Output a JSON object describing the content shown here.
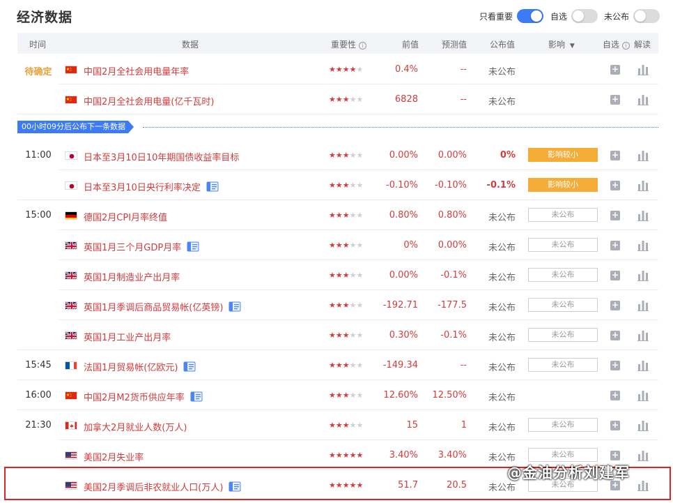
{
  "header": {
    "title": "经济数据",
    "toggles": [
      {
        "label": "只看重要",
        "on": true
      },
      {
        "label": "自选",
        "on": false
      },
      {
        "label": "未公布",
        "on": false
      }
    ]
  },
  "columns": {
    "time": "时间",
    "data": "数据",
    "importance": "重要性",
    "previous": "前值",
    "forecast": "预测值",
    "actual": "公布值",
    "impact": "影响",
    "watchlist": "自选",
    "analysis": "解读"
  },
  "banner": "00小时09分后公布下一条数据",
  "rows": [
    {
      "time": "待确定",
      "flag": "cn",
      "name": "中国2月全社会用电量年率",
      "doc": false,
      "stars": 4,
      "prev": "0.4%",
      "forecast": "--",
      "actual": "未公布",
      "actual_hot": false,
      "impact": ""
    },
    {
      "time": "",
      "flag": "cn",
      "name": "中国2月全社会用电量(亿千瓦时)",
      "doc": false,
      "stars": 3,
      "prev": "6828",
      "forecast": "--",
      "actual": "未公布",
      "actual_hot": false,
      "impact": ""
    },
    {
      "time": "11:00",
      "flag": "jp",
      "name": "日本至3月10日10年期国债收益率目标",
      "doc": false,
      "stars": 3,
      "prev": "0.00%",
      "forecast": "0.00%",
      "actual": "0%",
      "actual_hot": true,
      "impact": "影响较小"
    },
    {
      "time": "",
      "flag": "jp",
      "name": "日本至3月10日央行利率决定",
      "doc": true,
      "stars": 3,
      "prev": "-0.10%",
      "forecast": "-0.10%",
      "actual": "-0.1%",
      "actual_hot": true,
      "impact": "影响较小"
    },
    {
      "time": "15:00",
      "flag": "de",
      "name": "德国2月CPI月率终值",
      "doc": false,
      "stars": 3,
      "prev": "0.80%",
      "forecast": "0.80%",
      "actual": "未公布",
      "actual_hot": false,
      "impact": "未公布"
    },
    {
      "time": "",
      "flag": "uk",
      "name": "英国1月三个月GDP月率",
      "doc": true,
      "stars": 3,
      "prev": "0%",
      "forecast": "0.00%",
      "actual": "未公布",
      "actual_hot": false,
      "impact": "未公布"
    },
    {
      "time": "",
      "flag": "uk",
      "name": "英国1月制造业产出月率",
      "doc": false,
      "stars": 3,
      "prev": "0.00%",
      "forecast": "-0.1%",
      "actual": "未公布",
      "actual_hot": false,
      "impact": "未公布"
    },
    {
      "time": "",
      "flag": "uk",
      "name": "英国1月季调后商品贸易帐(亿英镑)",
      "doc": true,
      "stars": 3,
      "prev": "-192.71",
      "forecast": "-177.5",
      "actual": "未公布",
      "actual_hot": false,
      "impact": "未公布"
    },
    {
      "time": "",
      "flag": "uk",
      "name": "英国1月工业产出月率",
      "doc": false,
      "stars": 3,
      "prev": "0.30%",
      "forecast": "-0.1%",
      "actual": "未公布",
      "actual_hot": false,
      "impact": "未公布"
    },
    {
      "time": "15:45",
      "flag": "fr",
      "name": "法国1月贸易帐(亿欧元)",
      "doc": true,
      "stars": 3,
      "prev": "-149.34",
      "forecast": "--",
      "actual": "未公布",
      "actual_hot": false,
      "impact": "未公布"
    },
    {
      "time": "16:00",
      "flag": "cn",
      "name": "中国2月M2货币供应年率",
      "doc": true,
      "stars": 3,
      "prev": "12.60%",
      "forecast": "12.50%",
      "actual": "未公布",
      "actual_hot": false,
      "impact": ""
    },
    {
      "time": "21:30",
      "flag": "ca",
      "name": "加拿大2月就业人数(万人)",
      "doc": false,
      "stars": 3,
      "prev": "15",
      "forecast": "1",
      "actual": "未公布",
      "actual_hot": false,
      "impact": "未公布"
    },
    {
      "time": "",
      "flag": "us",
      "name": "美国2月失业率",
      "doc": false,
      "stars": 5,
      "prev": "3.40%",
      "forecast": "3.40%",
      "actual": "未公布",
      "actual_hot": false,
      "impact": "未公布"
    },
    {
      "time": "",
      "flag": "us",
      "name": "美国2月季调后非农就业人口(万人)",
      "doc": true,
      "stars": 5,
      "prev": "51.7",
      "forecast": "20.5",
      "actual": "未公布",
      "actual_hot": false,
      "impact": "未公布"
    }
  ],
  "watermark": "@金油分析刘建军",
  "colors": {
    "accent": "#3d7bf6",
    "value_red": "#d43b3b",
    "impact_small": "#f5ad38",
    "pending": "#e8a23a",
    "highlight": "#e02424"
  }
}
